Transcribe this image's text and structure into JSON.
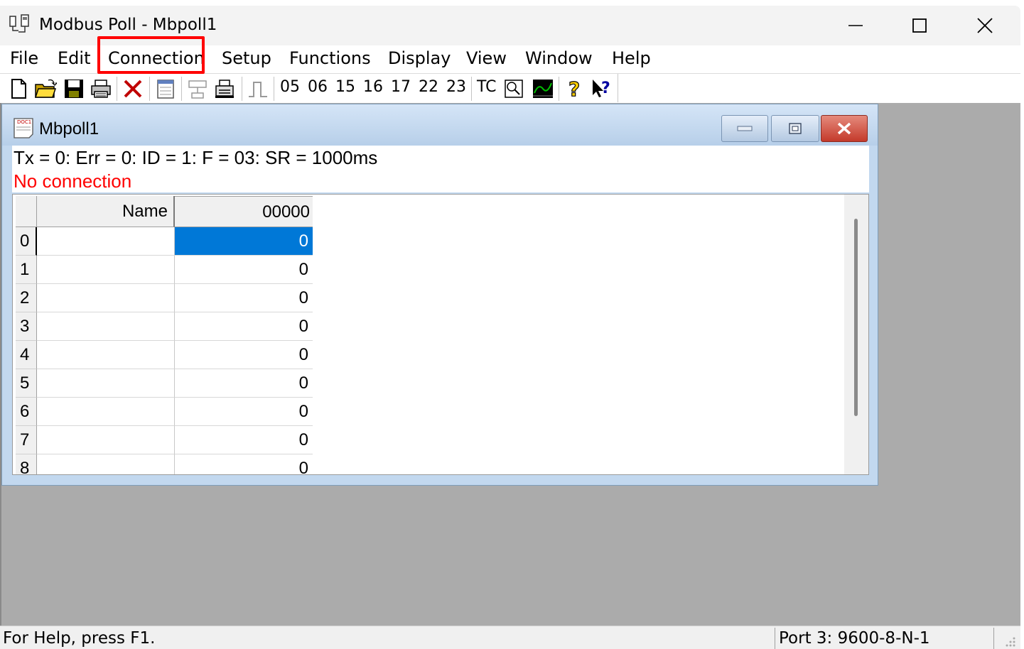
{
  "window": {
    "title": "Modbus Poll - Mbpoll1"
  },
  "menu": {
    "file": "File",
    "edit": "Edit",
    "connection": "Connection",
    "setup": "Setup",
    "functions": "Functions",
    "display": "Display",
    "view": "View",
    "window": "Window",
    "help": "Help"
  },
  "toolbar": {
    "fc05": "05",
    "fc06": "06",
    "fc15": "15",
    "fc16": "16",
    "fc17": "17",
    "fc22": "22",
    "fc23": "23",
    "tc": "TC",
    "icons": [
      "new-document-icon",
      "open-folder-icon",
      "save-icon",
      "print-icon",
      "disconnect-icon",
      "read-write-definition-icon",
      "connect-icon",
      "print-preview-icon",
      "pulse-icon",
      "traffic-monitor-icon",
      "chart-icon",
      "help-icon",
      "context-help-icon"
    ]
  },
  "child": {
    "title": "Mbpoll1",
    "status": "Tx = 0: Err = 0: ID = 1: F = 03: SR = 1000ms",
    "connection_status": "No connection",
    "connection_color": "#ff0000"
  },
  "grid": {
    "header_name": "Name",
    "header_address": "00000",
    "selected_color": "#0078d7",
    "rows": [
      {
        "index": "0",
        "name": "",
        "value": "0"
      },
      {
        "index": "1",
        "name": "",
        "value": "0"
      },
      {
        "index": "2",
        "name": "",
        "value": "0"
      },
      {
        "index": "3",
        "name": "",
        "value": "0"
      },
      {
        "index": "4",
        "name": "",
        "value": "0"
      },
      {
        "index": "5",
        "name": "",
        "value": "0"
      },
      {
        "index": "6",
        "name": "",
        "value": "0"
      },
      {
        "index": "7",
        "name": "",
        "value": "0"
      },
      {
        "index": "8",
        "name": "",
        "value": "0"
      }
    ]
  },
  "statusbar": {
    "help_text": "For Help, press F1.",
    "port_info": "Port 3: 9600-8-N-1"
  }
}
